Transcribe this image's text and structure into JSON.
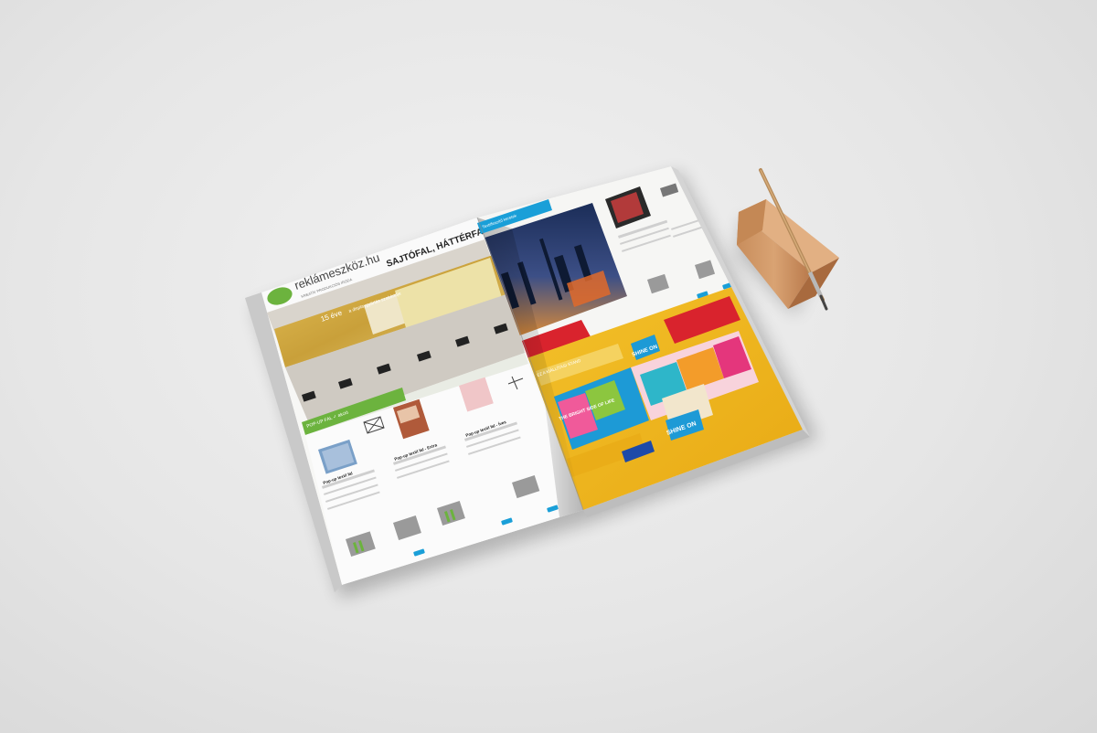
{
  "magazine": {
    "logo_text": "reklámeszköz.hu",
    "logo_tagline": "KREATÍV PRODUKCIÓS IRODA",
    "headline": "SAJTÓFAL, HÁTTÉRFAL",
    "years_text": "15 éve",
    "years_sub": "a displaygyártás szakértője",
    "left_section_tab": "POP-UP FAL ✓ akció",
    "product_1_title": "Pop-up textil fal",
    "product_2_title": "Pop-up textil fal - Extra",
    "product_3_title": "Pop-up textil fal - Íves",
    "right_section_tab": "Textilfeszítő keretek",
    "right_section_tab_2": "EZ A KIÁLLÍTÁSI STAND",
    "shine_on_1": "SHINE ON",
    "shine_on_2": "SHINE ON",
    "bright_side_text": "THE BRIGHT SIDE OF LIFE",
    "colors": {
      "brand_green": "#6cb33e",
      "accent_red": "#d9232d",
      "stand_yellow": "#f2b51a",
      "tab_blue": "#1a9fd8"
    }
  },
  "props": {
    "pencil_holder": "wooden pencil stand",
    "pencil": "pencil"
  }
}
